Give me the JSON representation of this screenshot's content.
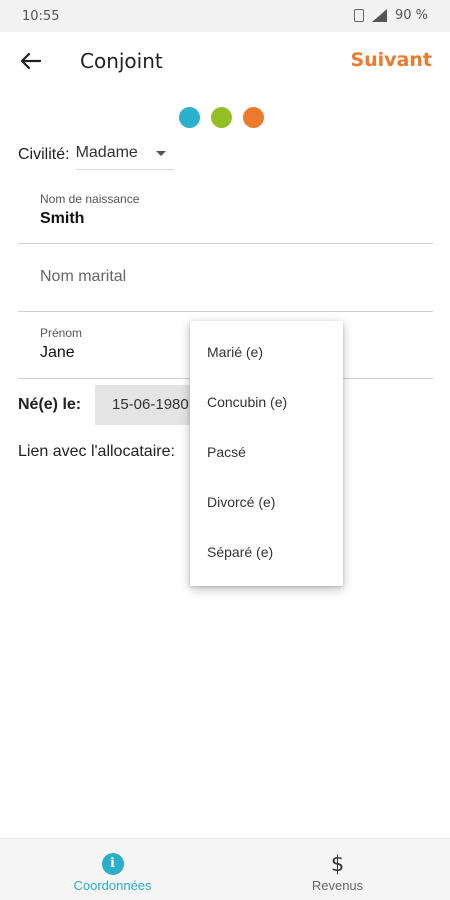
{
  "status_bar": {
    "time": "10:55",
    "battery": "90 %"
  },
  "header": {
    "title": "Conjoint",
    "next_label": "Suivant"
  },
  "steps": {
    "colors": [
      "#2bb1c9",
      "#93bf24",
      "#ec7a2d"
    ]
  },
  "form": {
    "civility_label": "Civilité:",
    "civility_value": "Madame",
    "birth_name_label": "Nom de naissance",
    "birth_name_value": "Smith",
    "marital_name_placeholder": "Nom marital",
    "first_name_label": "Prénom",
    "first_name_value": "Jane",
    "birth_date_label": "Né(e) le:",
    "birth_date_value": "15-06-1980",
    "relation_label": "Lien avec l'allocataire:"
  },
  "relation_menu": {
    "options": [
      "Marié (e)",
      "Concubin (e)",
      "Pacsé",
      "Divorcé (e)",
      "Séparé (e)"
    ]
  },
  "bottom_nav": {
    "items": [
      {
        "label": "Coordonnées",
        "icon": "info-icon",
        "active": true
      },
      {
        "label": "Revenus",
        "icon": "dollar-icon",
        "active": false
      }
    ],
    "active_color": "#2aaec9"
  }
}
